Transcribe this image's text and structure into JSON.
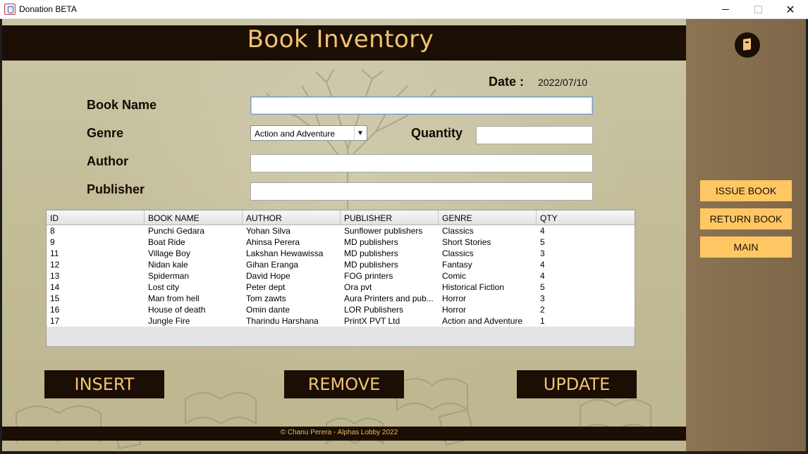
{
  "window": {
    "title": "Donation BETA",
    "close_glyph": "✕"
  },
  "header": {
    "title": "Book Inventory"
  },
  "form": {
    "date_label": "Date :",
    "date_value": "2022/07/10",
    "book_name_label": "Book Name",
    "genre_label": "Genre",
    "author_label": "Author",
    "publisher_label": "Publisher",
    "quantity_label": "Quantity",
    "genre_selected": "Action and Adventure",
    "genre_arrow": "▼",
    "book_name_value": "",
    "author_value": "",
    "publisher_value": "",
    "quantity_value": ""
  },
  "table": {
    "columns": [
      "ID",
      "BOOK NAME",
      "AUTHOR",
      "PUBLISHER",
      "GENRE",
      "QTY"
    ],
    "rows": [
      [
        "8",
        "Punchi Gedara",
        "Yohan Silva",
        "Sunflower publishers",
        "Classics",
        "4"
      ],
      [
        "9",
        "Boat Ride",
        "Ahinsa Perera",
        "MD publishers",
        "Short Stories",
        "5"
      ],
      [
        "11",
        "Village Boy",
        "Lakshan Hewawissa",
        "MD publishers",
        "Classics",
        "3"
      ],
      [
        "12",
        "Nidan kale",
        "Gihan Eranga",
        "MD publishers",
        "Fantasy",
        "4"
      ],
      [
        "13",
        "Spiderman",
        "David Hope",
        "FOG printers",
        "Comic",
        "4"
      ],
      [
        "14",
        "Lost city",
        "Peter dept",
        "Ora pvt",
        "Historical Fiction",
        "5"
      ],
      [
        "15",
        "Man from hell",
        "Tom zawts",
        "Aura Printers and pub...",
        "Horror",
        "3"
      ],
      [
        "16",
        "House of death",
        "Omin dante",
        "LOR Publishers",
        "Horror",
        "2"
      ],
      [
        "17",
        "Jungle Fire",
        "Tharindu Harshana",
        "PrintX PVT Ltd",
        "Action and Adventure",
        "1"
      ]
    ]
  },
  "actions": {
    "insert": "INSERT",
    "remove": "REMOVE",
    "update": "UPDATE"
  },
  "footer": {
    "text": "© Chanu Perera - Alphas Lobby 2022"
  },
  "side_panel": {
    "issue_book": "ISSUE BOOK",
    "return_book": "RETURN BOOK",
    "main": "MAIN"
  },
  "colors": {
    "dark": "#1b0e04",
    "gold": "#f2c373",
    "side_button": "#fec764",
    "side_panel": "#8b7453"
  }
}
